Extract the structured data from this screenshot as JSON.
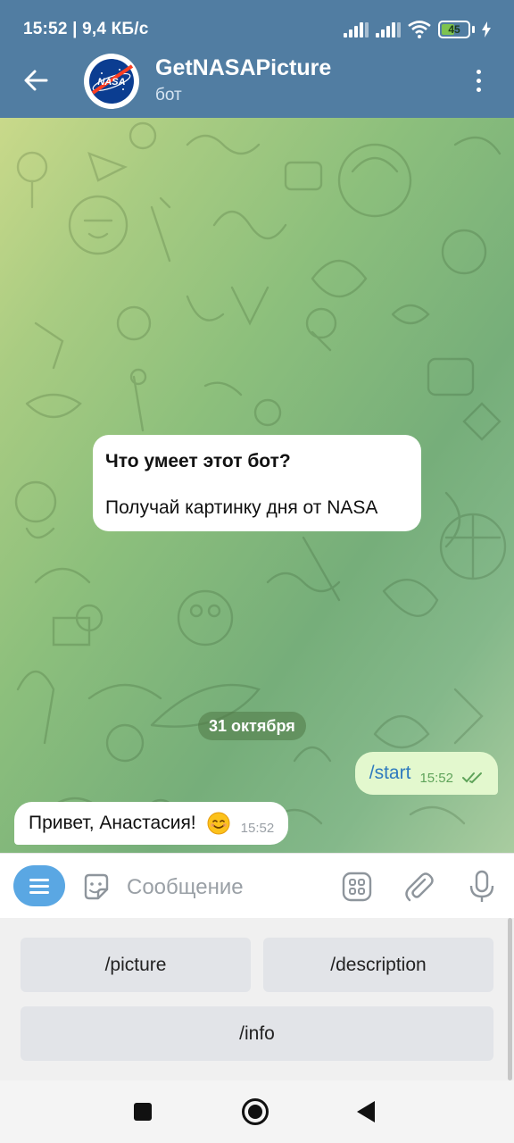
{
  "status_bar": {
    "time": "15:52",
    "speed": "9,4 КБ/с",
    "battery": "45"
  },
  "header": {
    "title": "GetNASAPicture",
    "subtitle": "бот",
    "avatar_text": "NASA"
  },
  "bot_info": {
    "title": "Что умеет этот бот?",
    "description": "Получай картинку дня от NASA"
  },
  "date_separator": "31 октября",
  "messages": [
    {
      "direction": "out",
      "text": "/start",
      "time": "15:52",
      "status": "read"
    },
    {
      "direction": "in",
      "text": "Привет, Анастасия!",
      "emoji": "smiling-face",
      "time": "15:52"
    }
  ],
  "input": {
    "placeholder": "Сообщение",
    "value": ""
  },
  "keyboard": {
    "buttons": [
      "/picture",
      "/description",
      "/info"
    ]
  },
  "colors": {
    "header": "#517da2",
    "outgoing_bubble": "#e3f8ce",
    "accent": "#5aa7e3"
  }
}
